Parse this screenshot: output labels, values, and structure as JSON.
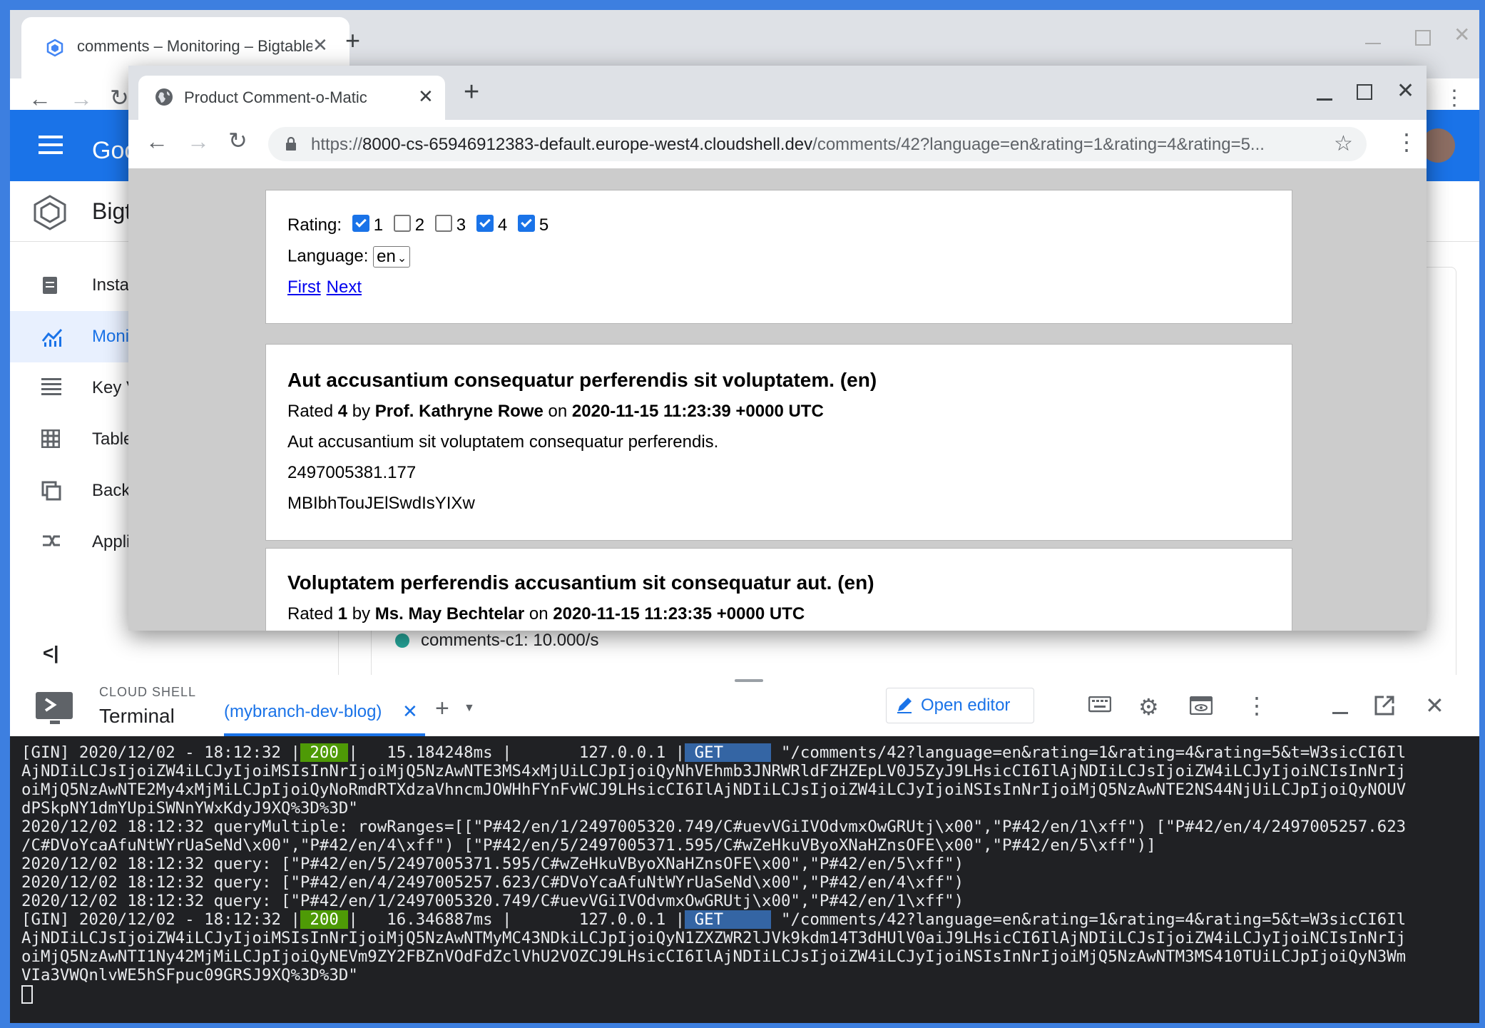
{
  "back_browser": {
    "tab_title": "comments – Monitoring – Bigtable",
    "gc_title": "Google Cloud",
    "product_title": "Bigtable",
    "sidebar_items": [
      {
        "label": "Instances",
        "icon": "instance-icon",
        "active": false
      },
      {
        "label": "Monitoring",
        "icon": "monitoring-chart-icon",
        "active": true
      },
      {
        "label": "Key Visualizer",
        "icon": "key-visualizer-icon",
        "active": false
      },
      {
        "label": "Tables",
        "icon": "table-icon",
        "active": false
      },
      {
        "label": "Backups",
        "icon": "backup-icon",
        "active": false
      },
      {
        "label": "Application profiles",
        "icon": "app-profile-icon",
        "active": false
      }
    ],
    "legend_text": "comments-c1: 10.000/s",
    "legend_color": "#26a69a"
  },
  "front_browser": {
    "tab_title": "Product Comment-o-Matic",
    "url_scheme": "https://",
    "url_host": "8000-cs-65946912383-default.europe-west4.cloudshell.dev",
    "url_path": "/comments/42?language=en&rating=1&rating=4&rating=5..."
  },
  "filters": {
    "rating_label": "Rating:",
    "ratings": [
      {
        "value": "1",
        "checked": true
      },
      {
        "value": "2",
        "checked": false
      },
      {
        "value": "3",
        "checked": false
      },
      {
        "value": "4",
        "checked": true
      },
      {
        "value": "5",
        "checked": true
      }
    ],
    "language_label": "Language:",
    "language_value": "en",
    "first_link": "First",
    "next_link": "Next"
  },
  "comments": [
    {
      "title": "Aut accusantium consequatur perferendis sit voluptatem. (en)",
      "rated_prefix": "Rated",
      "rating": "4",
      "by_word": "by",
      "author": "Prof. Kathryne Rowe",
      "on_word": "on",
      "date": "2020-11-15 11:23:39 +0000 UTC",
      "body": "Aut accusantium sit voluptatem consequatur perferendis.",
      "timestamp": "2497005381.177",
      "id": "MBIbhTouJElSwdIsYIXw"
    },
    {
      "title": "Voluptatem perferendis accusantium sit consequatur aut. (en)",
      "rated_prefix": "Rated",
      "rating": "1",
      "by_word": "by",
      "author": "Ms. May Bechtelar",
      "on_word": "on",
      "date": "2020-11-15 11:23:35 +0000 UTC"
    }
  ],
  "shell": {
    "label": "CLOUD SHELL",
    "terminal_label": "Terminal",
    "tab_name": "(mybranch-dev-blog)",
    "open_editor": "Open editor"
  },
  "terminal": {
    "l1_pre": "[GIN] 2020/12/02 - 18:12:32 |",
    "l1_status": " 200 ",
    "l1_mid": "|   15.184248ms |       127.0.0.1 |",
    "l1_method": " GET     ",
    "l1_post": " \"/comments/42?language=en&rating=1&rating=4&rating=5&t=W3sicCI6Il",
    "l2": "AjNDIiLCJsIjoiZW4iLCJyIjoiMSIsInNrIjoiMjQ5NzAwNTE3MS4xMjUiLCJpIjoiQyNhVEhmb3JNRWRldFZHZEpLV0J5ZyJ9LHsicCI6IlAjNDIiLCJsIjoiZW4iLCJyIjoiNCIsInNrIj",
    "l3": "oiMjQ5NzAwNTE2My4xMjMiLCJpIjoiQyNoRmdRTXdzaVhncmJOWHhFYnFvWCJ9LHsicCI6IlAjNDIiLCJsIjoiZW4iLCJyIjoiNSIsInNrIjoiMjQ5NzAwNTE2NS44NjUiLCJpIjoiQyNOUV",
    "l4": "dPSkpNY1dmYUpiSWNnYWxKdyJ9XQ%3D%3D\"",
    "l5": "2020/12/02 18:12:32 queryMultiple: rowRanges=[[\"P#42/en/1/2497005320.749/C#uevVGiIVOdvmxOwGRUtj\\x00\",\"P#42/en/1\\xff\") [\"P#42/en/4/2497005257.623",
    "l6": "/C#DVoYcaAfuNtWYrUaSeNd\\x00\",\"P#42/en/4\\xff\") [\"P#42/en/5/2497005371.595/C#wZeHkuVByoXNaHZnsOFE\\x00\",\"P#42/en/5\\xff\")]",
    "l7": "2020/12/02 18:12:32 query: [\"P#42/en/5/2497005371.595/C#wZeHkuVByoXNaHZnsOFE\\x00\",\"P#42/en/5\\xff\")",
    "l8": "2020/12/02 18:12:32 query: [\"P#42/en/4/2497005257.623/C#DVoYcaAfuNtWYrUaSeNd\\x00\",\"P#42/en/4\\xff\")",
    "l9": "2020/12/02 18:12:32 query: [\"P#42/en/1/2497005320.749/C#uevVGiIVOdvmxOwGRUtj\\x00\",\"P#42/en/1\\xff\")",
    "l10_pre": "[GIN] 2020/12/02 - 18:12:32 |",
    "l10_status": " 200 ",
    "l10_mid": "|   16.346887ms |       127.0.0.1 |",
    "l10_method": " GET     ",
    "l10_post": " \"/comments/42?language=en&rating=1&rating=4&rating=5&t=W3sicCI6Il",
    "l11": "AjNDIiLCJsIjoiZW4iLCJyIjoiMSIsInNrIjoiMjQ5NzAwNTMyMC43NDkiLCJpIjoiQyN1ZXZWR2lJVk9kdm14T3dHUlV0aiJ9LHsicCI6IlAjNDIiLCJsIjoiZW4iLCJyIjoiNCIsInNrIj",
    "l12": "oiMjQ5NzAwNTI1Ny42MjMiLCJpIjoiQyNEVm9ZY2FBZnVOdFdZclVhU2VOZCJ9LHsicCI6IlAjNDIiLCJsIjoiZW4iLCJyIjoiNSIsInNrIjoiMjQ5NzAwNTM3MS410TUiLCJpIjoiQyN3Wm",
    "l13": "VIa3VWQnlvWE5hSFpuc09GRSJ9XQ%3D%3D\""
  }
}
